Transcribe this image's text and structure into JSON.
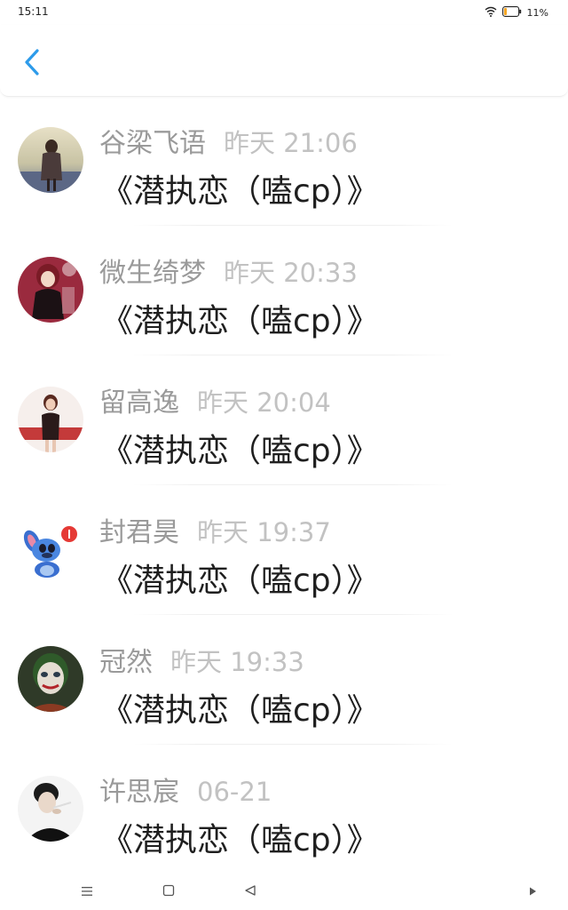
{
  "status": {
    "time": "15:11",
    "battery": "11%"
  },
  "header": {
    "back_icon": "chevron-left-icon",
    "accent": "#2d9bea"
  },
  "messages": [
    {
      "name": "谷梁飞语",
      "time": "昨天 21:06",
      "text": "《潜执恋（嗑cp）》"
    },
    {
      "name": "微生绮梦",
      "time": "昨天 20:33",
      "text": "《潜执恋（嗑cp）》"
    },
    {
      "name": "留高逸",
      "time": "昨天 20:04",
      "text": "《潜执恋（嗑cp）》"
    },
    {
      "name": "封君昊",
      "time": "昨天 19:37",
      "text": "《潜执恋（嗑cp）》"
    },
    {
      "name": "冠然",
      "time": "昨天 19:33",
      "text": "《潜执恋（嗑cp）》"
    },
    {
      "name": "许思宸",
      "time": "06-21",
      "text": "《潜执恋（嗑cp）》"
    }
  ],
  "nav": {
    "icons": [
      "menu-icon",
      "home-icon",
      "back-triangle-icon",
      "play-icon"
    ]
  }
}
